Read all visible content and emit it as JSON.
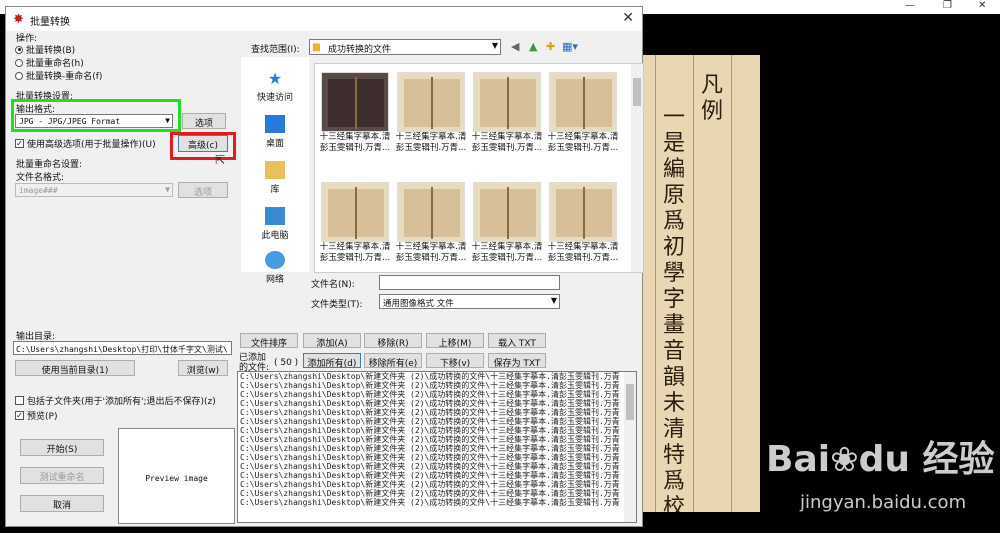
{
  "background": {
    "window_controls": [
      "—",
      "❐",
      "✕"
    ]
  },
  "dialog": {
    "title": "批量转换",
    "close": "✕",
    "operation_label": "操作:",
    "operations": [
      {
        "label": "批量转换(B)",
        "selected": true
      },
      {
        "label": "批量重命名(h)",
        "selected": false
      },
      {
        "label": "批量转换-重命名(f)",
        "selected": false
      }
    ],
    "convert_settings_label": "批量转换设置:",
    "output_format_label": "输出格式:",
    "output_format_value": "JPG - JPG/JPEG Format",
    "options_button": "选项",
    "advanced_checkbox": "使用高级选项(用于批量操作)(U)",
    "advanced_checked": true,
    "advanced_button": "高级(c)",
    "rename_settings_label": "批量重命名设置:",
    "filename_format_label": "文件名格式:",
    "filename_format_value": "image###",
    "rename_options_button": "选项",
    "output_dir_label": "输出目录:",
    "output_dir_value": "C:\\Users\\zhangshi\\Desktop\\打印\\廿体千字文\\测试\\",
    "use_current_dir_button": "使用当前目录(1)",
    "browse_button": "浏览(w)",
    "include_subfolders": "包括子文件夹(用于'添加所有';退出后不保存)(z)",
    "include_subfolders_checked": false,
    "preview_checkbox": "预览(P)",
    "preview_checked": true,
    "start_button": "开始(S)",
    "test_rename_button": "测试重命名",
    "cancel_button": "取消",
    "preview_text": "Preview image"
  },
  "browser": {
    "lookin_label": "查找范围(I):",
    "lookin_value": "成功转换的文件",
    "places": [
      "快速访问",
      "桌面",
      "库",
      "此电脑",
      "网络"
    ],
    "thumbnails": [
      {
        "line1": "十三经集字摹本.清",
        "line2": "彭玉雯辑刊.万青..."
      },
      {
        "line1": "十三经集字摹本.清",
        "line2": "彭玉雯辑刊.万青..."
      },
      {
        "line1": "十三经集字摹本.清",
        "line2": "彭玉雯辑刊.万青..."
      },
      {
        "line1": "十三经集字摹本.清",
        "line2": "彭玉雯辑刊.万青..."
      },
      {
        "line1": "十三经集字摹本.清",
        "line2": "彭玉雯辑刊.万青..."
      },
      {
        "line1": "十三经集字摹本.清",
        "line2": "彭玉雯辑刊.万青..."
      },
      {
        "line1": "十三经集字摹本.清",
        "line2": "彭玉雯辑刊.万青..."
      },
      {
        "line1": "十三经集字摹本.清",
        "line2": "彭玉雯辑刊.万青..."
      }
    ],
    "filename_label": "文件名(N):",
    "filename_value": "",
    "filetype_label": "文件类型(T):",
    "filetype_value": "通用图像格式 文件"
  },
  "filelist": {
    "sort_button": "文件排序",
    "add_button": "添加(A)",
    "remove_button": "移除(R)",
    "up_button": "上移(M)",
    "load_button": "载入 TXT",
    "added_label": "已添加",
    "files_label": "的文件:",
    "count": "( 50 )",
    "add_all_button": "添加所有(d)",
    "remove_all_button": "移除所有(e)",
    "down_button": "下移(v)",
    "save_button": "保存为 TXT",
    "line_text": "C:\\Users\\zhangshi\\Desktop\\新建文件夹 (2)\\成功转换的文件\\十三经集字摹本.清彭玉雯辑刊.万青",
    "visible_lines": 15
  },
  "page_image": {
    "columns": [
      "凡例",
      "一是編原爲初學字畫音韻未清特爲校"
    ]
  },
  "watermark": {
    "brand": "Bai",
    "brand2": "du",
    "chinese": "经验",
    "url": "jingyan.baidu.com"
  },
  "colors": {
    "highlight_green": "#22dd22",
    "highlight_red": "#e41b1b",
    "dialog_bg": "#f0f0f0"
  }
}
